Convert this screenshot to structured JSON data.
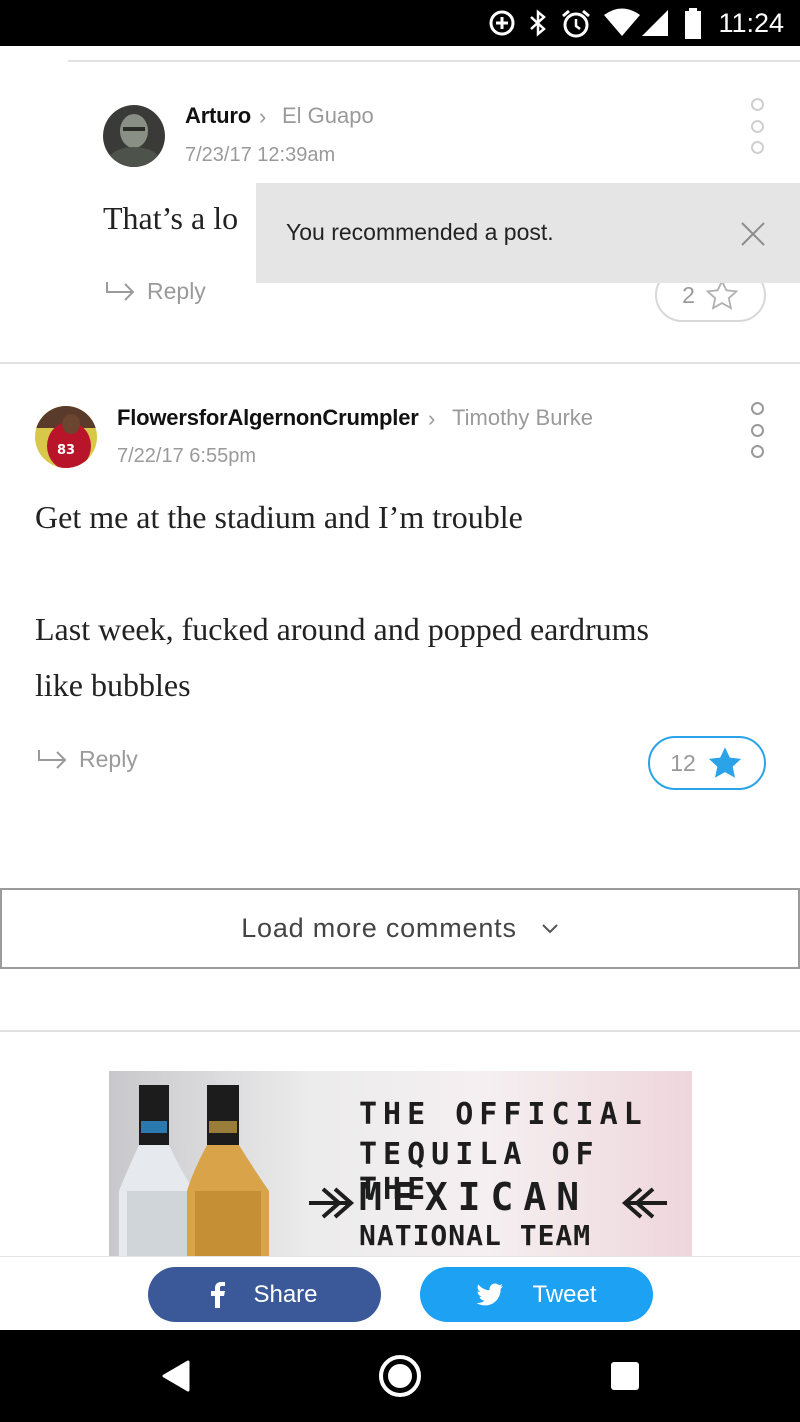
{
  "status_bar": {
    "time": "11:24",
    "icons": [
      "data-saver-icon",
      "bluetooth-icon",
      "alarm-icon",
      "wifi-icon",
      "cell-signal-icon",
      "battery-icon"
    ]
  },
  "toast": {
    "message": "You recommended a post.",
    "close_icon": "close-icon"
  },
  "comments": [
    {
      "author": "Arturo",
      "reply_to": "El Guapo",
      "timestamp": "7/23/17 12:39am",
      "text_lines": [
        "That’s a lo"
      ],
      "reply_label": "Reply",
      "recommend_count": "2",
      "recommended": false
    },
    {
      "author": "FlowersforAlgernonCrumpler",
      "reply_to": "Timothy Burke",
      "timestamp": "7/22/17 6:55pm",
      "text_lines": [
        "Get me at the stadium and I’m trouble",
        "Last week, fucked around and popped eardrums",
        "like bubbles"
      ],
      "reply_label": "Reply",
      "recommend_count": "12",
      "recommended": true
    }
  ],
  "load_more": {
    "label": "Load more comments"
  },
  "ad": {
    "lines": [
      "THE OFFICIAL",
      "TEQUILA OF THE",
      "MEXICAN",
      "NATIONAL TEAM"
    ]
  },
  "share_bar": {
    "share_label": "Share",
    "tweet_label": "Tweet"
  },
  "colors": {
    "accent_blue": "#2aa3e8",
    "facebook": "#3b5998",
    "twitter": "#1da1f2",
    "muted_text": "#9a9a9a"
  }
}
